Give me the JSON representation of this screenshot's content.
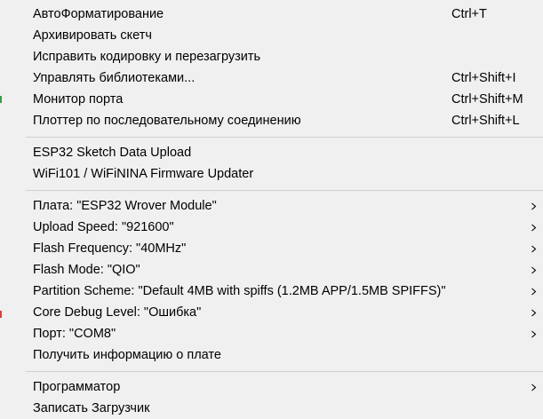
{
  "menu": {
    "group1": [
      {
        "label": "АвтоФорматирование",
        "shortcut": "Ctrl+T"
      },
      {
        "label": "Архивировать скетч",
        "shortcut": ""
      },
      {
        "label": "Исправить кодировку и перезагрузить",
        "shortcut": ""
      },
      {
        "label": "Управлять библиотеками...",
        "shortcut": "Ctrl+Shift+I"
      },
      {
        "label": "Монитор порта",
        "shortcut": "Ctrl+Shift+M"
      },
      {
        "label": "Плоттер по последовательному соединению",
        "shortcut": "Ctrl+Shift+L"
      }
    ],
    "group2": [
      {
        "label": "ESP32 Sketch Data Upload"
      },
      {
        "label": "WiFi101 / WiFiNINA Firmware Updater"
      }
    ],
    "group3": [
      {
        "label": "Плата: \"ESP32 Wrover Module\"",
        "submenu": true
      },
      {
        "label": "Upload Speed: \"921600\"",
        "submenu": true
      },
      {
        "label": "Flash Frequency: \"40MHz\"",
        "submenu": true
      },
      {
        "label": "Flash Mode: \"QIO\"",
        "submenu": true
      },
      {
        "label": "Partition Scheme: \"Default 4MB with spiffs (1.2MB APP/1.5MB SPIFFS)\"",
        "submenu": true
      },
      {
        "label": "Core Debug Level: \"Ошибка\"",
        "submenu": true
      },
      {
        "label": "Порт: \"COM8\"",
        "submenu": true
      },
      {
        "label": "Получить информацию о плате",
        "submenu": false
      }
    ],
    "group4": [
      {
        "label": "Программатор",
        "submenu": true
      },
      {
        "label": "Записать Загрузчик",
        "submenu": false
      }
    ],
    "submenu_icon": "chevron-right-icon"
  }
}
